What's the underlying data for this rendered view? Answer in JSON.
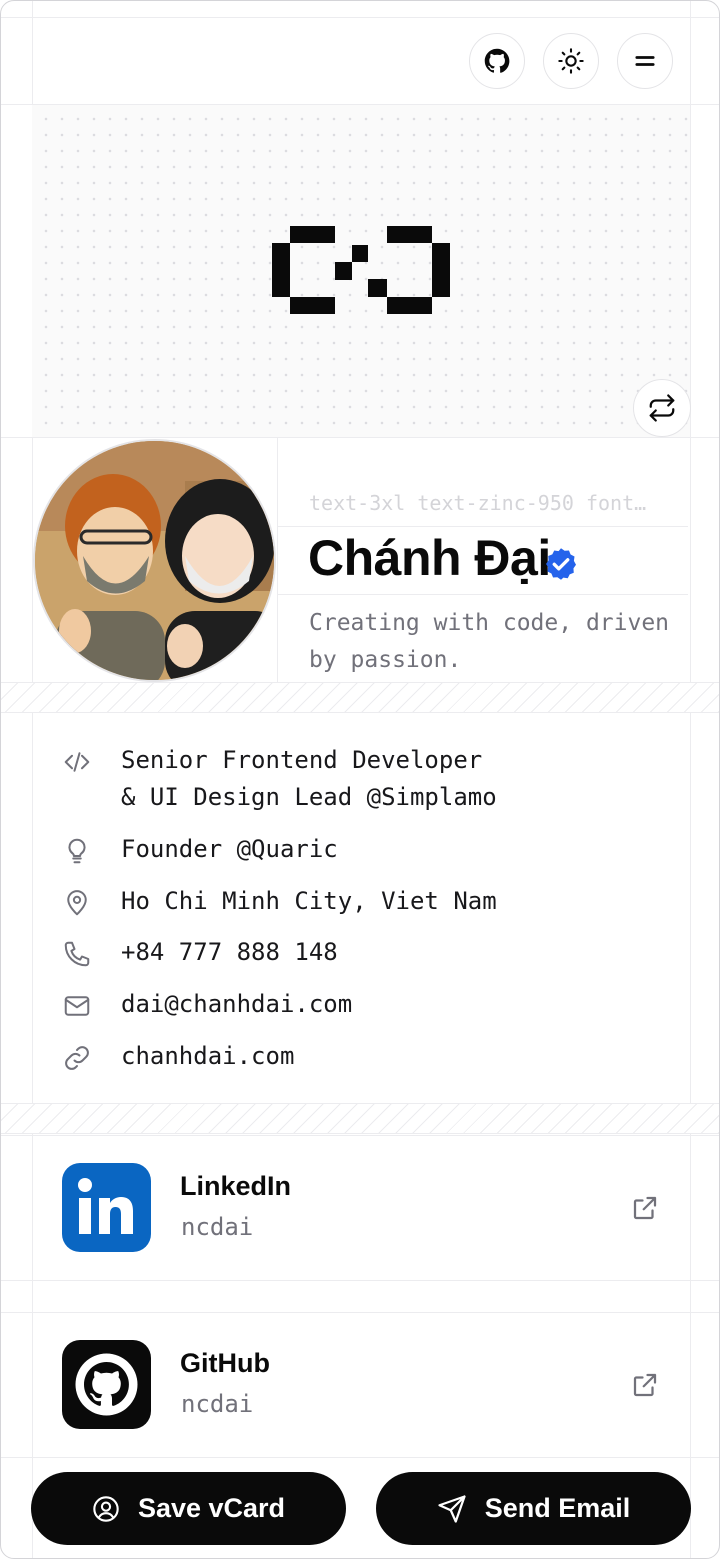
{
  "header": {
    "github_icon": "github-icon",
    "theme_icon": "sun-icon",
    "menu_icon": "menu-icon"
  },
  "hero": {
    "swap_icon": "repeat-icon"
  },
  "profile": {
    "code_hint": "text-3xl text-zinc-950 font…",
    "name": "Chánh Đại",
    "tagline": "Creating with code, driven by passion."
  },
  "info": [
    {
      "icon": "code-icon",
      "text": "Senior Frontend Developer\n& UI Design Lead @Simplamo"
    },
    {
      "icon": "lightbulb-icon",
      "text": "Founder @Quaric"
    },
    {
      "icon": "map-pin-icon",
      "text": "Ho Chi Minh City, Viet Nam"
    },
    {
      "icon": "phone-icon",
      "text": "+84 777 888 148"
    },
    {
      "icon": "mail-icon",
      "text": "dai@chanhdai.com"
    },
    {
      "icon": "link-icon",
      "text": "chanhdai.com"
    }
  ],
  "social": [
    {
      "name": "LinkedIn",
      "handle": "ncdai",
      "color": "#0a66c2"
    },
    {
      "name": "GitHub",
      "handle": "ncdai",
      "color": "#0a0a0a"
    }
  ],
  "actions": {
    "save_vcard": "Save vCard",
    "send_email": "Send Email"
  },
  "colors": {
    "accent": "#2563eb",
    "muted": "#71717a"
  }
}
